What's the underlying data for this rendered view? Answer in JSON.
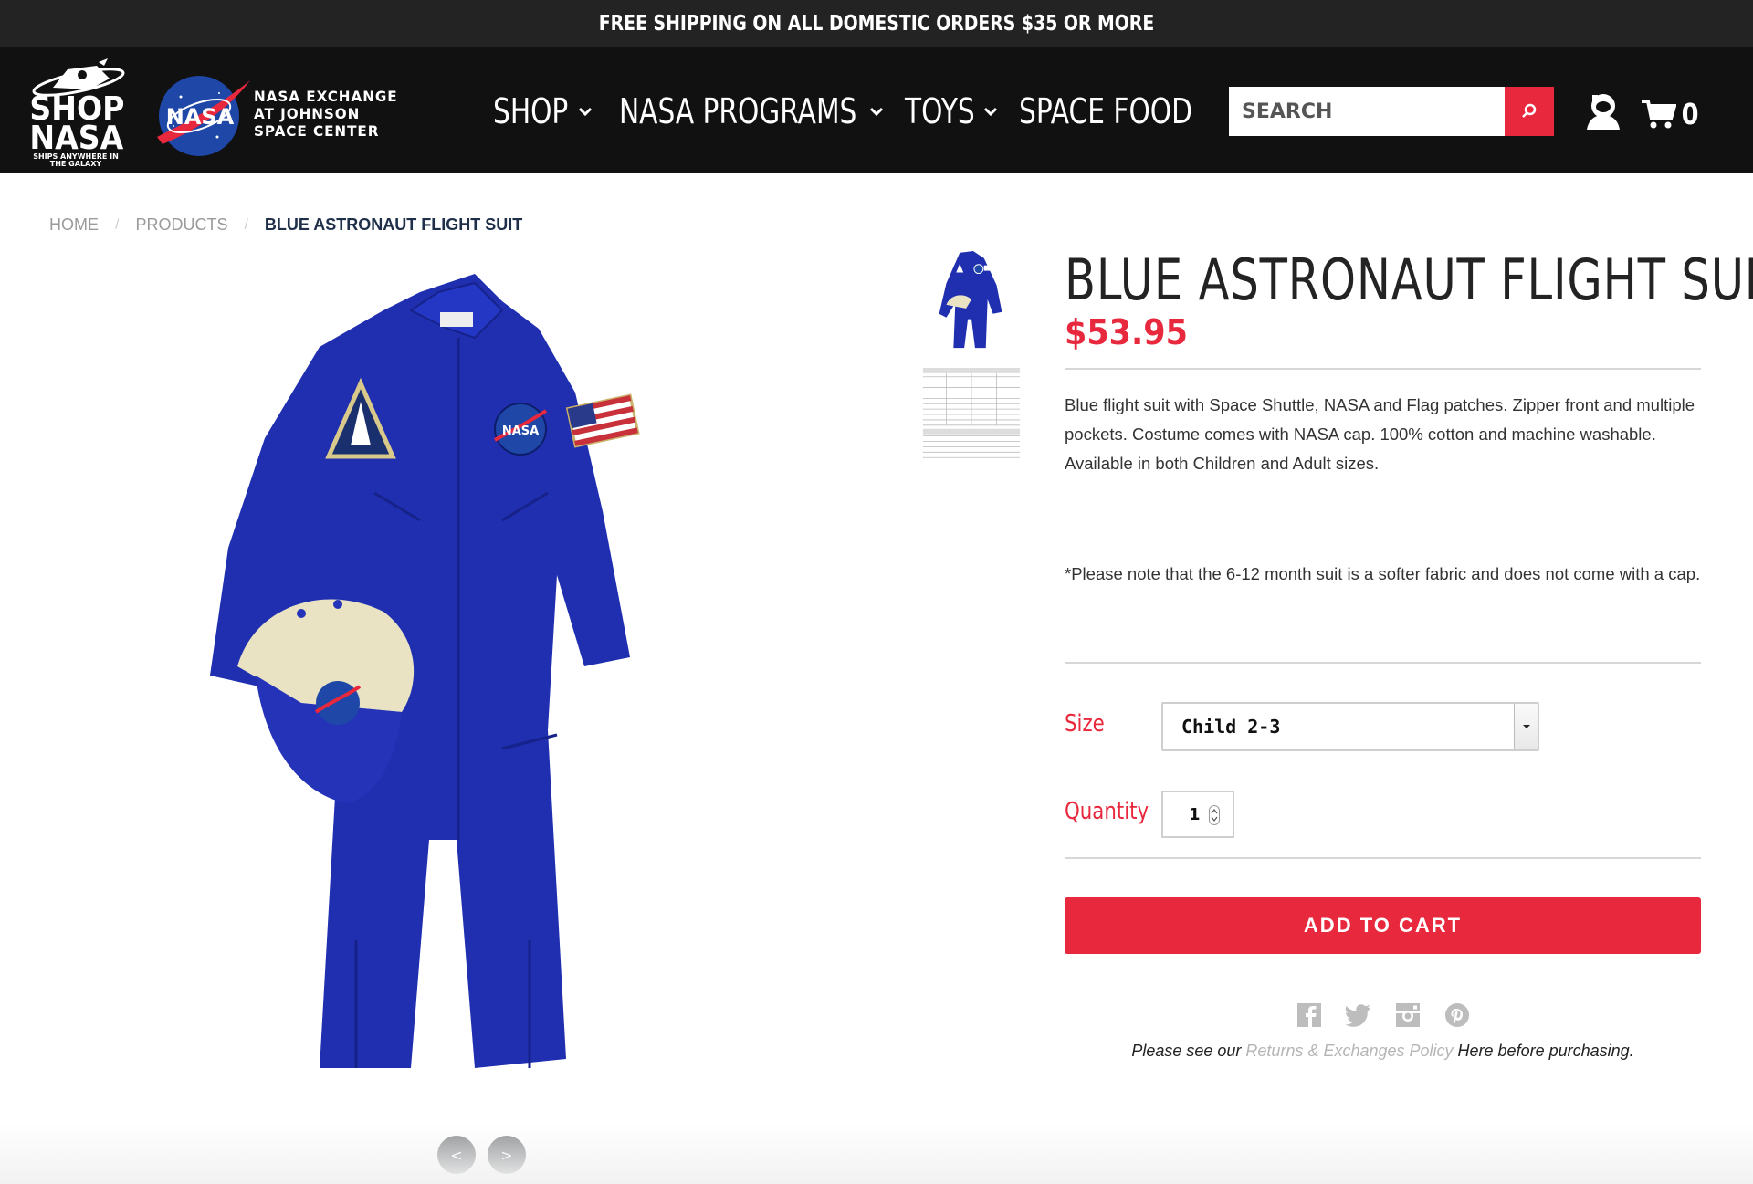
{
  "promo": {
    "text": "FREE SHIPPING ON ALL DOMESTIC ORDERS $35 OR MORE"
  },
  "header": {
    "logo_shop_word": "SHOP NASA",
    "logo_shop_tagline": "SHIPS ANYWHERE IN THE GALAXY",
    "logo_nasa_badge": "NASA",
    "exchange_lines": [
      "NASA EXCHANGE",
      "AT JOHNSON",
      "SPACE CENTER"
    ],
    "nav": [
      {
        "label": "SHOP",
        "icon": "chevron-down-icon"
      },
      {
        "label": "NASA PROGRAMS",
        "icon": "chevron-down-icon"
      },
      {
        "label": "TOYS",
        "icon": "chevron-down-icon"
      },
      {
        "label": "SPACE FOOD"
      }
    ],
    "search": {
      "placeholder": "SEARCH",
      "icon": "search-icon"
    },
    "account_icon": "astronaut-account-icon",
    "cart": {
      "icon": "cart-icon",
      "count": "0"
    }
  },
  "breadcrumb": [
    {
      "label": "HOME"
    },
    {
      "label": "PRODUCTS"
    },
    {
      "label": "BLUE ASTRONAUT FLIGHT SUIT"
    }
  ],
  "gallery": {
    "prev_label": "<",
    "next_label": ">",
    "thumbnails": [
      "flight-suit-thumbnail",
      "size-chart-thumbnail"
    ]
  },
  "product": {
    "title": "BLUE ASTRONAUT FLIGHT SUIT",
    "price": "$53.95",
    "description": "Blue flight suit with Space Shuttle, NASA and Flag patches. Zipper front and multiple pockets. Costume comes with NASA cap. 100% cotton and machine washable. Available in both Children and Adult sizes.",
    "note": "*Please note that the 6-12 month suit is a softer fabric and does not come with a cap.",
    "size_label": "Size",
    "size_value": "Child 2-3",
    "quantity_label": "Quantity",
    "quantity_value": "1",
    "add_to_cart": "ADD TO CART"
  },
  "social": [
    "facebook-icon",
    "twitter-icon",
    "instagram-icon",
    "pinterest-icon"
  ],
  "policy": {
    "prefix": "Please see our ",
    "link": "Returns & Exchanges Policy",
    "suffix": " Here before purchasing."
  },
  "colors": {
    "brand_red": "#e8283d",
    "header_bg": "#111111",
    "promo_bg": "#232323",
    "suit_blue": "#1f2fb0"
  }
}
